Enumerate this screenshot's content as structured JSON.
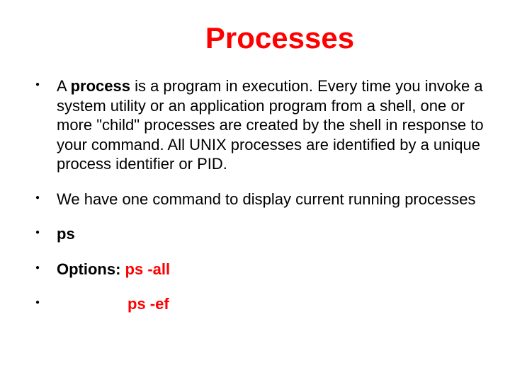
{
  "title": "Processes",
  "items": {
    "p1_pre": "A ",
    "p1_bold": "process",
    "p1_post": " is a program in execution. Every time you invoke a system utility or an application program from a shell, one or more \"child\" processes are created by the shell in response to your command. All UNIX processes are identified by a unique process identifier or PID.",
    "p2": "We have one command to display current running processes",
    "p3": "ps",
    "p4_label": "Options: ",
    "p4_cmd": "ps -all",
    "p5_cmd": "ps -ef"
  }
}
